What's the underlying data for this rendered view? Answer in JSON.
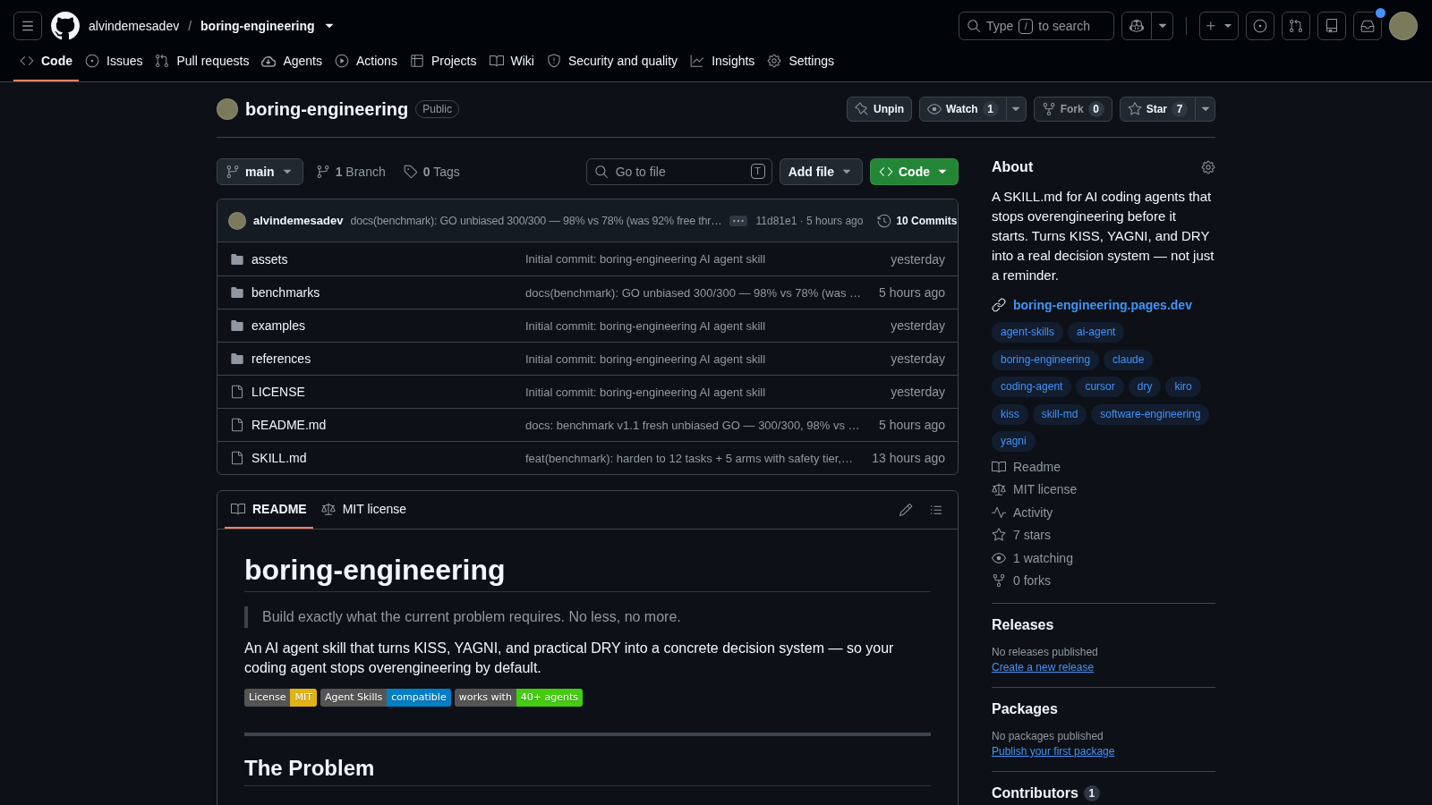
{
  "header": {
    "owner": "alvindemesadev",
    "separator": "/",
    "repo": "boring-engineering",
    "search": {
      "prefix": "Type",
      "key": "/",
      "suffix": "to search"
    },
    "notifications_unread": true
  },
  "repo_tabs": [
    {
      "label": "Code",
      "selected": true
    },
    {
      "label": "Issues",
      "selected": false
    },
    {
      "label": "Pull requests",
      "selected": false
    },
    {
      "label": "Agents",
      "selected": false
    },
    {
      "label": "Actions",
      "selected": false
    },
    {
      "label": "Projects",
      "selected": false
    },
    {
      "label": "Wiki",
      "selected": false
    },
    {
      "label": "Security and quality",
      "selected": false
    },
    {
      "label": "Insights",
      "selected": false
    },
    {
      "label": "Settings",
      "selected": false
    }
  ],
  "repo": {
    "name": "boring-engineering",
    "visibility": "Public",
    "actions": [
      {
        "label": "Unpin",
        "disabled": false,
        "menu": false
      },
      {
        "label": "Watch",
        "count": "1",
        "disabled": false,
        "menu": true
      },
      {
        "label": "Fork",
        "count": "0",
        "disabled": true,
        "menu": false
      },
      {
        "label": "Star",
        "count": "7",
        "disabled": false,
        "menu": true
      }
    ]
  },
  "branch_bar": {
    "branch": "main",
    "branches": "**1** Branch",
    "tags": "**0** Tags",
    "file_search": {
      "placeholder": "Go to file",
      "shortcut": "T"
    },
    "add_file": "Add file",
    "code": "Code"
  },
  "latest_commit": {
    "author": "alvindemesadev",
    "message": "docs(benchmark): GO unbiased 300/300 — 98% vs 78% (was 92% free thr…",
    "info": "11d81e1 · 5 hours ago",
    "commits": "10 Commits"
  },
  "files": [
    {
      "kind": "folder",
      "name": "assets",
      "message": "Initial commit: boring-engineering AI agent skill",
      "time": "yesterday"
    },
    {
      "kind": "folder",
      "name": "benchmarks",
      "message": "docs(benchmark): GO unbiased 300/300 — 98% vs 78% (was …",
      "time": "5 hours ago"
    },
    {
      "kind": "folder",
      "name": "examples",
      "message": "Initial commit: boring-engineering AI agent skill",
      "time": "yesterday"
    },
    {
      "kind": "folder",
      "name": "references",
      "message": "Initial commit: boring-engineering AI agent skill",
      "time": "yesterday"
    },
    {
      "kind": "file",
      "name": "LICENSE",
      "message": "Initial commit: boring-engineering AI agent skill",
      "time": "yesterday"
    },
    {
      "kind": "file",
      "name": "README.md",
      "message": "docs: benchmark v1.1 fresh unbiased GO — 300/300, 98% vs …",
      "time": "5 hours ago"
    },
    {
      "kind": "file",
      "name": "SKILL.md",
      "message": "feat(benchmark): harden to 12 tasks + 5 arms with safety tier,…",
      "time": "13 hours ago"
    }
  ],
  "readme": {
    "tabs": [
      {
        "label": "README",
        "selected": true
      },
      {
        "label": "MIT license",
        "selected": false
      }
    ],
    "title": "boring-engineering",
    "quote": "Build exactly what the current problem requires. No less, no more.",
    "paragraph": "An AI agent skill that turns KISS, YAGNI, and practical DRY into a concrete decision system — so your coding agent stops overengineering by default.",
    "badges": [
      {
        "label": "License",
        "value": "MIT",
        "color": "#dfb317"
      },
      {
        "label": "Agent Skills",
        "value": "compatible",
        "color": "#007ec6"
      },
      {
        "label": "works with",
        "value": "40+ agents",
        "color": "#44cc11"
      }
    ],
    "heading": "The Problem"
  },
  "sidebar": {
    "about": {
      "title": "About",
      "description": "A SKILL.md for AI coding agents that stops overengineering before it starts. Turns KISS, YAGNI, and DRY into a real decision system — not just a reminder.",
      "website": "boring-engineering.pages.dev",
      "topics": [
        "agent-skills",
        "ai-agent",
        "boring-engineering",
        "claude",
        "coding-agent",
        "cursor",
        "dry",
        "kiro",
        "kiss",
        "skill-md",
        "software-engineering",
        "yagni"
      ],
      "stats": [
        "Readme",
        "MIT license",
        "Activity",
        "7 stars",
        "1 watching",
        "0 forks"
      ]
    },
    "releases": {
      "title": "Releases",
      "note": "No releases published",
      "link": "Create a new release"
    },
    "packages": {
      "title": "Packages",
      "note": "No packages published",
      "link": "Publish your first package"
    },
    "contributors": {
      "title": "Contributors",
      "count": "1"
    }
  }
}
